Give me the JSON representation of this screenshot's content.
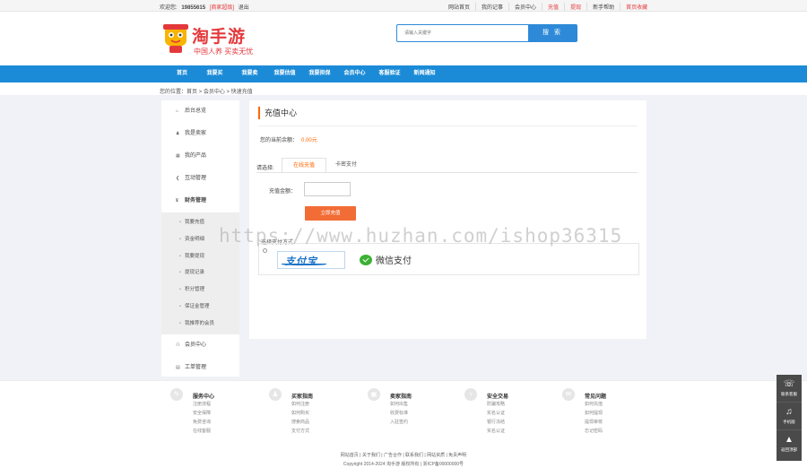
{
  "topbar": {
    "welcome": "欢迎您:",
    "user_id": "19855615",
    "dealer": "[商家超级]",
    "logout": "退出",
    "links": [
      "网站首页",
      "我的记事",
      "会员中心",
      "充值",
      "提现",
      "新手帮助",
      "首页收藏"
    ]
  },
  "header": {
    "logo_title": "淘手游",
    "logo_slogan": "中国人养  买卖无忧",
    "search_placeholder": "请输入关键字",
    "search_button": "搜 索"
  },
  "nav": {
    "items": [
      "首页",
      "我要买",
      "我要卖",
      "我要估值",
      "我要担保",
      "会员中心",
      "客服验证",
      "新闻通知"
    ]
  },
  "breadcrumb": "您的位置：首页 > 会员中心 > 快速充值",
  "sidebar": {
    "items": [
      {
        "label": "后台总览",
        "icon": "home-icon",
        "glyph": "⌂"
      },
      {
        "label": "我是卖家",
        "icon": "user-icon",
        "glyph": "♟"
      },
      {
        "label": "我的产品",
        "icon": "grid-icon",
        "glyph": "▦"
      },
      {
        "label": "互动管理",
        "icon": "share-icon",
        "glyph": "❮"
      },
      {
        "label": "财务管理",
        "icon": "finance-icon",
        "glyph": "¥"
      }
    ],
    "subitems": [
      "我要充值",
      "资金明细",
      "我要提现",
      "提现记录",
      "积分管理",
      "保证金管理",
      "我推荐的会员"
    ],
    "bottom_items": [
      {
        "label": "会员中心",
        "icon": "members-icon",
        "glyph": "⚇"
      },
      {
        "label": "工单管理",
        "icon": "ticket-icon",
        "glyph": "▤"
      }
    ]
  },
  "main": {
    "title": "充值中心",
    "balance_label": "您的当前余额：",
    "balance_value": "0.00元",
    "method_label": "请选择:",
    "tabs": [
      "在线充值",
      "卡密支付"
    ],
    "amount_label": "充值金额：",
    "submit": "立即充值",
    "choose_label": "选择支付方式",
    "alipay": "支付宝",
    "wechat": "微信支付"
  },
  "watermark": "https://www.huzhan.com/ishop36315",
  "footer": {
    "columns": [
      {
        "title": "服务中心",
        "glyph": "✎",
        "links": [
          "注册流程",
          "安全保障",
          "免费咨询",
          "在线客服"
        ]
      },
      {
        "title": "买家指南",
        "glyph": "♟",
        "links": [
          "如何注册",
          "如何购买",
          "搜索商品",
          "支付方式"
        ]
      },
      {
        "title": "卖家指南",
        "glyph": "▣",
        "links": [
          "如何出售",
          "收费标准",
          "入驻签约"
        ]
      },
      {
        "title": "安全交易",
        "glyph": "♀",
        "links": [
          "防骗攻略",
          "实名认证",
          "银行冻结",
          "实名认证"
        ]
      },
      {
        "title": "常见问题",
        "glyph": "✉",
        "links": [
          "如何充值",
          "如何提现",
          "提现审核",
          "忘记密码"
        ]
      }
    ],
    "links": "网站首页 | 关于我们 | 广告合作 | 联系我们 | 网站资质 | 免责声明",
    "copyright": "Copyright 2014-2024 淘手游 版权所有 | 浙ICP备00000000号"
  },
  "float_bar": [
    {
      "label": "联系客服",
      "icon": "chat-icon",
      "glyph": "☏"
    },
    {
      "label": "手机版",
      "icon": "headset-icon",
      "glyph": "♫"
    },
    {
      "label": "返回顶部",
      "icon": "top-icon",
      "glyph": "▲"
    }
  ],
  "colors": {
    "brand_blue": "#1b8bd8",
    "accent_orange": "#f26c36",
    "brand_red": "#e4393c"
  }
}
